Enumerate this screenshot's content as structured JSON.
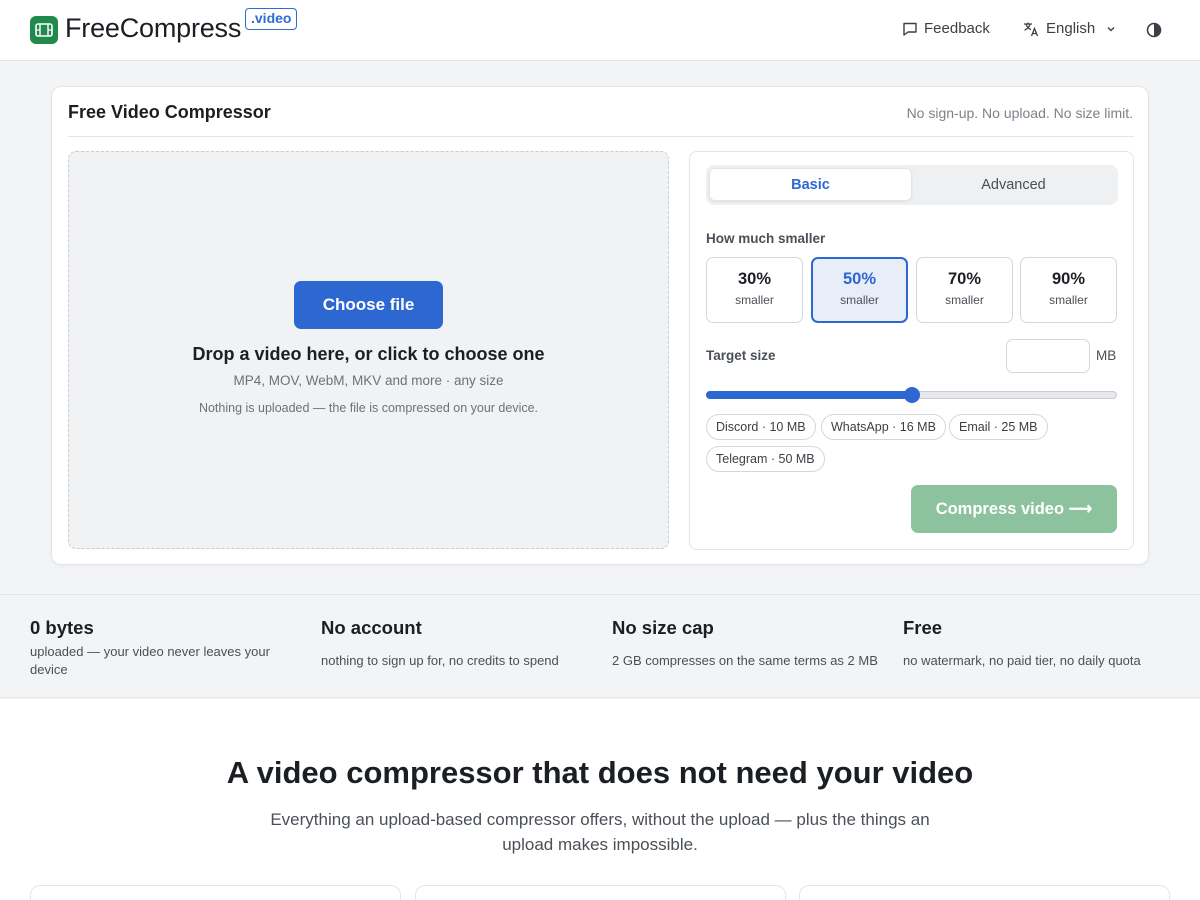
{
  "header": {
    "logo_text": "FreeCompress",
    "logo_badge": ".video",
    "feedback_label": "Feedback",
    "language_label": "English",
    "icons": {
      "logo": "film-icon",
      "feedback": "message-square-icon",
      "language": "translate-icon",
      "dropdown": "chevron-down-icon",
      "theme": "contrast-icon"
    }
  },
  "card": {
    "title": "Free Video Compressor",
    "note": "No sign-up. No upload. No size limit."
  },
  "dropzone": {
    "button_label": "Choose file",
    "title": "Drop a video here, or click to choose one",
    "formats": "MP4, MOV, WebM, MKV and more · any size",
    "privacy_note": "Nothing is uploaded — the file is compressed on your device."
  },
  "settings": {
    "tabs": [
      {
        "label": "Basic",
        "active": true
      },
      {
        "label": "Advanced",
        "active": false
      }
    ],
    "smaller_label": "How much smaller",
    "presets": [
      {
        "percent": "30%",
        "sub": "smaller",
        "active": false
      },
      {
        "percent": "50%",
        "sub": "smaller",
        "active": true
      },
      {
        "percent": "70%",
        "sub": "smaller",
        "active": false
      },
      {
        "percent": "90%",
        "sub": "smaller",
        "active": false
      }
    ],
    "target_label": "Target size",
    "target_value": "",
    "target_unit": "MB",
    "slider_fraction": 0.5,
    "chips": [
      "Discord · 10 MB",
      "WhatsApp · 16 MB",
      "Email · 25 MB",
      "Telegram · 50 MB"
    ],
    "compress_label": "Compress video ⟶"
  },
  "stats": [
    {
      "title": "0 bytes",
      "desc": "uploaded — your video never leaves your device"
    },
    {
      "title": "No account",
      "desc": "nothing to sign up for, no credits to spend"
    },
    {
      "title": "No size cap",
      "desc": "2 GB compresses on the same terms as 2 MB"
    },
    {
      "title": "Free",
      "desc": "no watermark, no paid tier, no daily quota"
    }
  ],
  "section": {
    "title": "A video compressor that does not need your video",
    "subtitle": "Everything an upload-based compressor offers, without the upload — plus the things an upload makes impossible."
  },
  "colors": {
    "brand_green": "#1f8a4c",
    "accent_blue": "#2d67d2",
    "compress_disabled": "#8dc29f"
  }
}
